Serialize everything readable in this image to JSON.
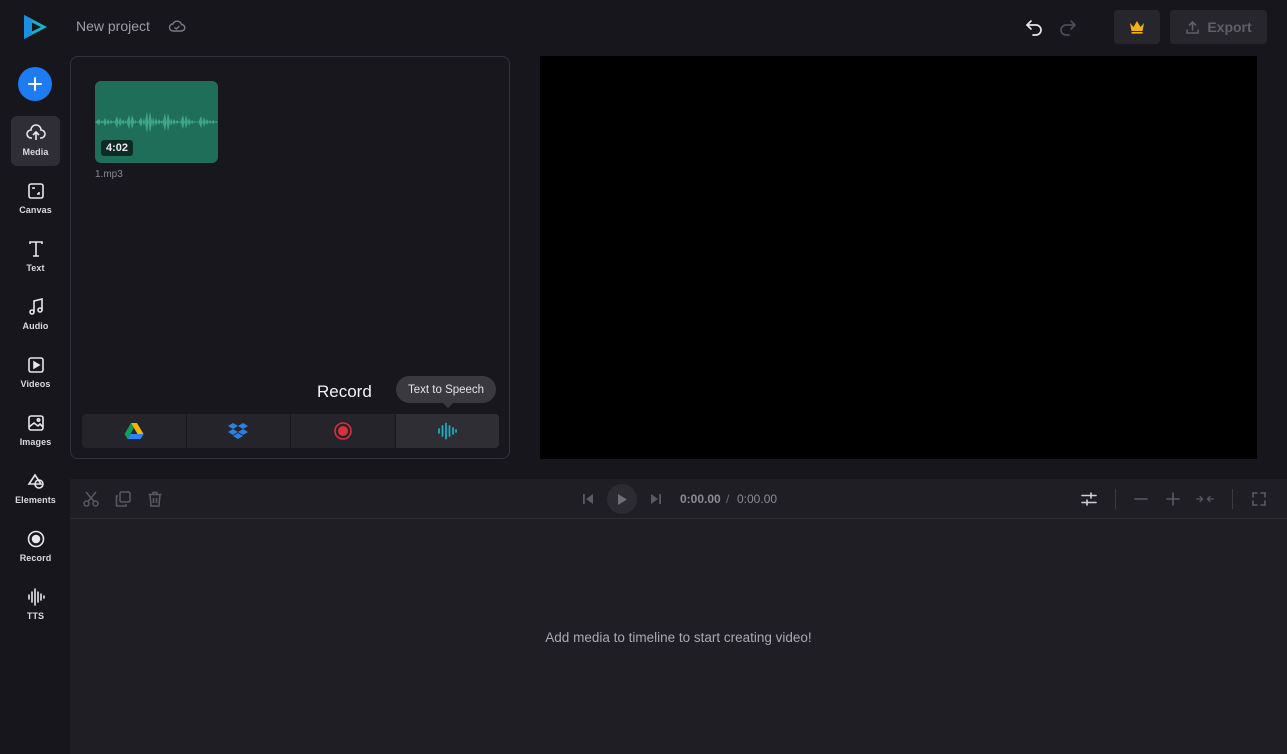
{
  "header": {
    "project_title": "New project",
    "export_label": "Export"
  },
  "sidebar": {
    "items": [
      {
        "label": "Media",
        "icon": "cloud-upload-icon"
      },
      {
        "label": "Canvas",
        "icon": "canvas-icon"
      },
      {
        "label": "Text",
        "icon": "text-icon"
      },
      {
        "label": "Audio",
        "icon": "music-note-icon"
      },
      {
        "label": "Videos",
        "icon": "video-play-icon"
      },
      {
        "label": "Images",
        "icon": "image-icon"
      },
      {
        "label": "Elements",
        "icon": "shapes-icon"
      },
      {
        "label": "Record",
        "icon": "record-icon"
      },
      {
        "label": "TTS",
        "icon": "waveform-icon"
      }
    ]
  },
  "media": {
    "file_name": "1.mp3",
    "duration": "4:02",
    "record_label": "Record",
    "tooltip": "Text to Speech",
    "sources": [
      "google-drive-icon",
      "dropbox-icon",
      "record-icon",
      "text-to-speech-icon"
    ]
  },
  "timeline": {
    "current_time": "0:00.00",
    "separator": "/",
    "total_time": "0:00.00",
    "empty_message": "Add media to timeline to start creating video!"
  },
  "colors": {
    "accent": "#1d7cf2",
    "premium": "#f2b20f",
    "record_red": "#d6313c",
    "tts_teal": "#19b3c6",
    "thumb_green": "#1f6e5a"
  }
}
